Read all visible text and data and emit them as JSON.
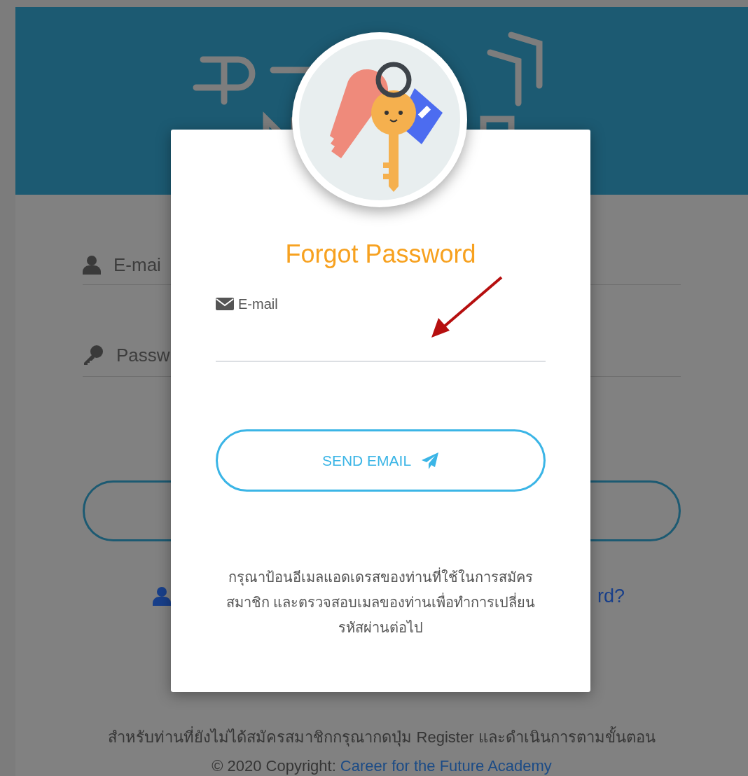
{
  "login_form": {
    "email_placeholder": "E-mai",
    "password_placeholder": "Passw",
    "forgot_link": "rd?"
  },
  "footer": {
    "note": "สำหรับท่านที่ยังไม่ได้สมัครสมาชิกกรุณากดปุ่ม Register และดำเนินการตามขั้นตอน",
    "copyright": "© 2020 Copyright:",
    "copyright_link": "Career for the Future Academy"
  },
  "dialog": {
    "title": "Forgot Password",
    "email_label": "E-mail",
    "button": "SEND EMAIL",
    "instructions": "กรุณาป้อนอีเมลแอดเดรสของท่านที่ใช้ในการสมัครสมาชิก และตรวจสอบเมลของท่านเพื่อทำการเปลี่ยนรหัสผ่านต่อไป"
  }
}
